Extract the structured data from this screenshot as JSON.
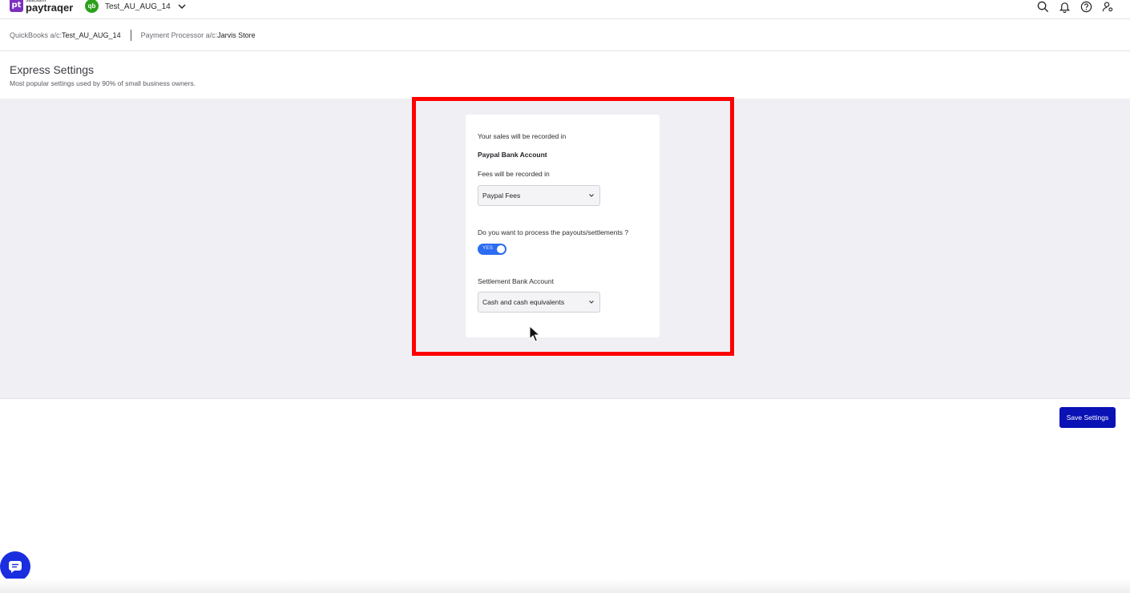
{
  "brand": {
    "small_text": "saasant",
    "name": "paytraqer",
    "mark": "pt"
  },
  "company": {
    "name": "Test_AU_AUG_14",
    "badge": "qb"
  },
  "topbar_icons": [
    "search-icon",
    "bell-icon",
    "help-icon",
    "user-settings-icon"
  ],
  "account_bar": {
    "qb_label": "QuickBooks a/c:",
    "qb_value": "Test_AU_AUG_14",
    "processor_label": "Payment Processor a/c:",
    "processor_value": "Jarvis Store"
  },
  "header": {
    "title": "Express Settings",
    "subtitle": "Most popular settings used by 90% of small business owners."
  },
  "settings_card": {
    "sales_label": "Your sales will be recorded in",
    "sales_account": "Paypal Bank Account",
    "fees_label": "Fees will be recorded in",
    "fees_select_value": "Paypal Fees",
    "payout_question": "Do you want to process the payouts/settlements ?",
    "payout_toggle_label": "YES",
    "payout_toggle_on": true,
    "settlement_label": "Settlement Bank Account",
    "settlement_select_value": "Cash and cash equivalents"
  },
  "actions": {
    "save_label": "Save Settings"
  },
  "colors": {
    "brand_purple": "#7b2fbf",
    "qb_green": "#2ca01c",
    "toggle_blue": "#2c6cf0",
    "save_button": "#0a12b5",
    "highlight_red": "#ff0000",
    "panel_gray": "#f0f0f4"
  }
}
